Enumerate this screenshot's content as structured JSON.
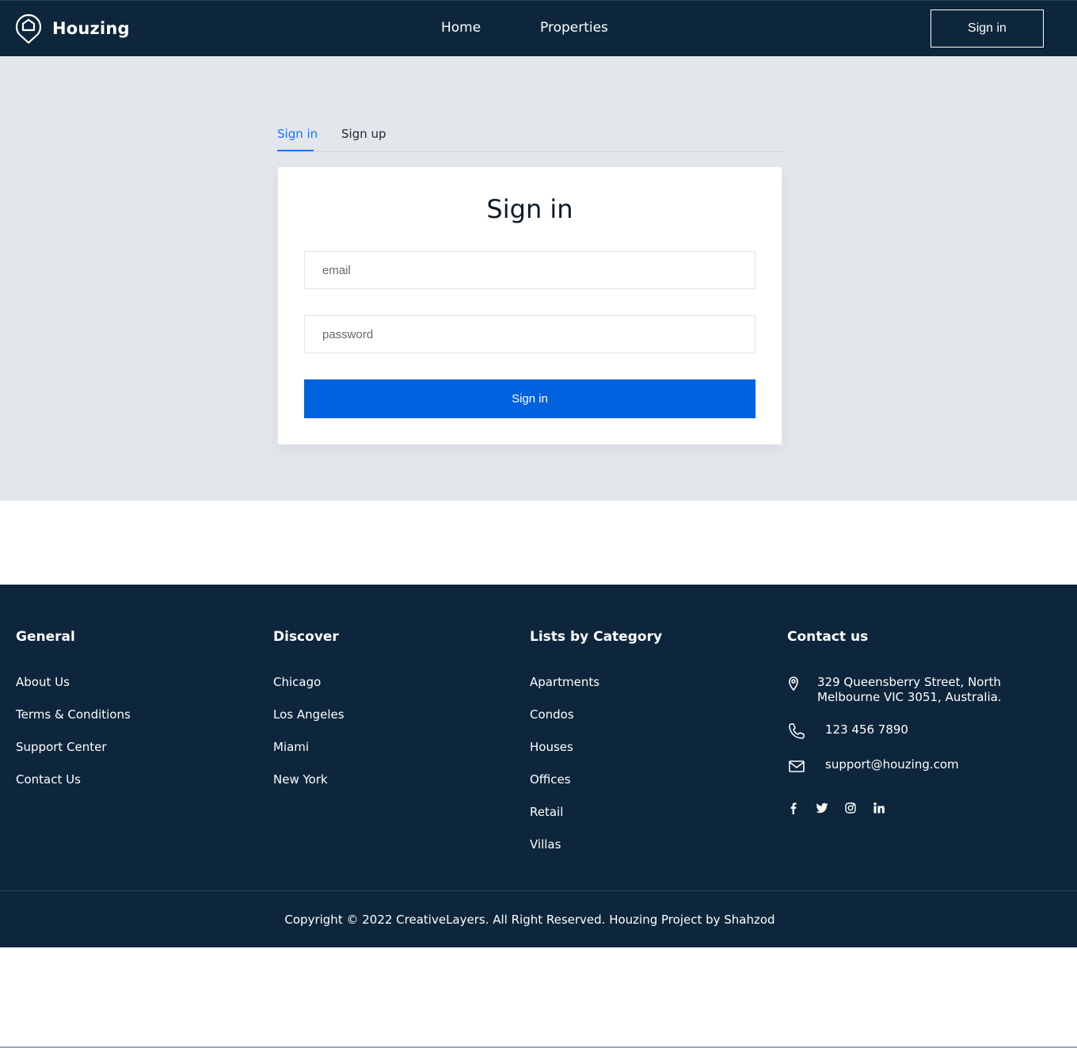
{
  "header": {
    "logo_text": "Houzing",
    "nav": [
      "Home",
      "Properties"
    ],
    "signin_label": "Sign in"
  },
  "auth": {
    "tabs": [
      "Sign in",
      "Sign up"
    ],
    "active_tab": "Sign in",
    "title": "Sign in",
    "email_placeholder": "email",
    "password_placeholder": "password",
    "submit_label": "Sign in"
  },
  "footer": {
    "general": {
      "title": "General",
      "links": [
        "About Us",
        "Terms & Conditions",
        "Support Center",
        "Contact Us"
      ]
    },
    "discover": {
      "title": "Discover",
      "links": [
        "Chicago",
        "Los Angeles",
        "Miami",
        "New York"
      ]
    },
    "categories": {
      "title": "Lists by Category",
      "links": [
        "Apartments",
        "Condos",
        "Houses",
        "Offices",
        "Retail",
        "Villas"
      ]
    },
    "contact": {
      "title": "Contact us",
      "address_line1": "329 Queensberry Street, North",
      "address_line2": "Melbourne VIC 3051, Australia.",
      "phone": "123 456 7890",
      "email": "support@houzing.com",
      "socials": [
        "facebook-icon",
        "twitter-icon",
        "instagram-icon",
        "linkedin-icon"
      ]
    },
    "copyright": "Copyright © 2022 CreativeLayers. All Right Reserved. Houzing Project by Shahzod"
  },
  "colors": {
    "navy": "#0d263b",
    "accent": "#0061df",
    "tab_active": "#1677ff",
    "page_bg": "#e3e7ec"
  }
}
